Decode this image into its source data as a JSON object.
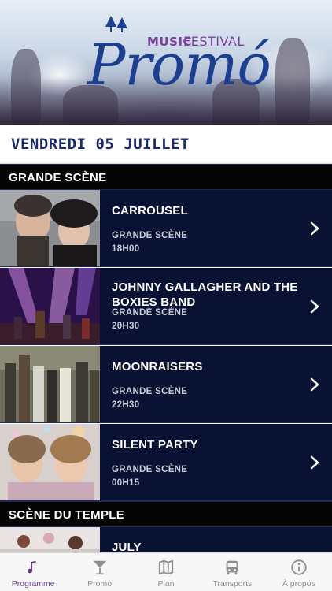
{
  "header": {
    "logo": {
      "music": "MUSIC",
      "festival": "FESTIVAL",
      "name": "Promó"
    }
  },
  "date": "VENDREDI 05 JUILLET",
  "sections": [
    {
      "title": "GRANDE SCÈNE",
      "events": [
        {
          "title": "CARROUSEL",
          "stage": "GRANDE SCÈNE",
          "time": "18H00"
        },
        {
          "title": "JOHNNY GALLAGHER AND THE BOXIES BAND",
          "stage": "GRANDE SCÈNE",
          "time": "20H30"
        },
        {
          "title": "MOONRAISERS",
          "stage": "GRANDE SCÈNE",
          "time": "22H30"
        },
        {
          "title": "SILENT PARTY",
          "stage": "GRANDE SCÈNE",
          "time": "00H15"
        }
      ]
    },
    {
      "title": "SCÈNE DU TEMPLE",
      "events": [
        {
          "title": "JULY"
        }
      ]
    }
  ],
  "tabs": [
    {
      "label": "Programme",
      "icon": "music-note-icon",
      "active": true
    },
    {
      "label": "Promo",
      "icon": "cocktail-glass-icon",
      "active": false
    },
    {
      "label": "Plan",
      "icon": "map-icon",
      "active": false
    },
    {
      "label": "Transports",
      "icon": "bus-icon",
      "active": false
    },
    {
      "label": "À propos",
      "icon": "info-icon",
      "active": false
    }
  ],
  "colors": {
    "row_background": "#091233",
    "section_background": "#050505",
    "date_text": "#1b2a6b",
    "logo_blue": "#1c3f8f",
    "logo_purple": "#7a3f9e",
    "tab_active": "#6b3a8f",
    "tab_inactive": "#8e8e93"
  }
}
